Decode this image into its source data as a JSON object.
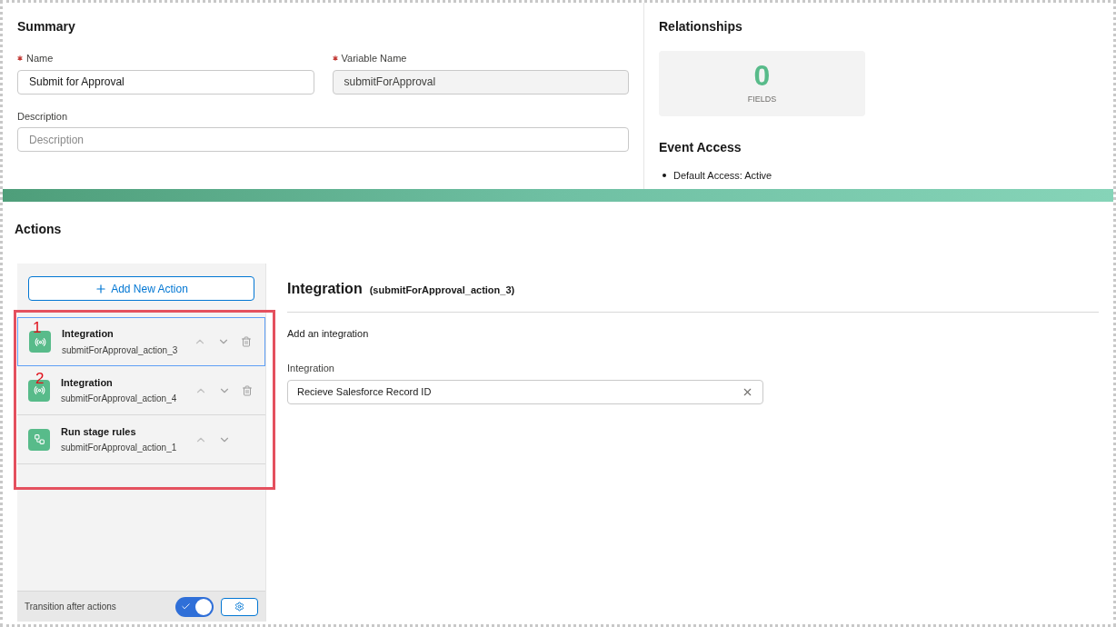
{
  "summary": {
    "title": "Summary",
    "name": {
      "label": "Name",
      "required": true,
      "value": "Submit for Approval"
    },
    "variable_name": {
      "label": "Variable Name",
      "required": true,
      "value": "submitForApproval"
    },
    "description": {
      "label": "Description",
      "placeholder": "Description"
    }
  },
  "relationships": {
    "title": "Relationships",
    "count": "0",
    "count_label": "FIELDS"
  },
  "event_access": {
    "title": "Event Access",
    "items": [
      "Default Access: Active"
    ]
  },
  "actions": {
    "title": "Actions",
    "add_button": "Add New Action",
    "items": [
      {
        "kind": "integration",
        "title": "Integration",
        "subtitle": "submitForApproval_action_3",
        "selected": true,
        "deletable": true,
        "annotation": "1"
      },
      {
        "kind": "integration",
        "title": "Integration",
        "subtitle": "submitForApproval_action_4",
        "selected": false,
        "deletable": true,
        "annotation": "2"
      },
      {
        "kind": "rules",
        "title": "Run stage rules",
        "subtitle": "submitForApproval_action_1",
        "selected": false,
        "deletable": false
      }
    ],
    "footer": {
      "label": "Transition after actions",
      "on": true
    },
    "detail": {
      "title": "Integration",
      "id": "(submitForApproval_action_3)",
      "hint": "Add an integration",
      "field_label": "Integration",
      "field_value": "Recieve Salesforce Record ID"
    }
  }
}
